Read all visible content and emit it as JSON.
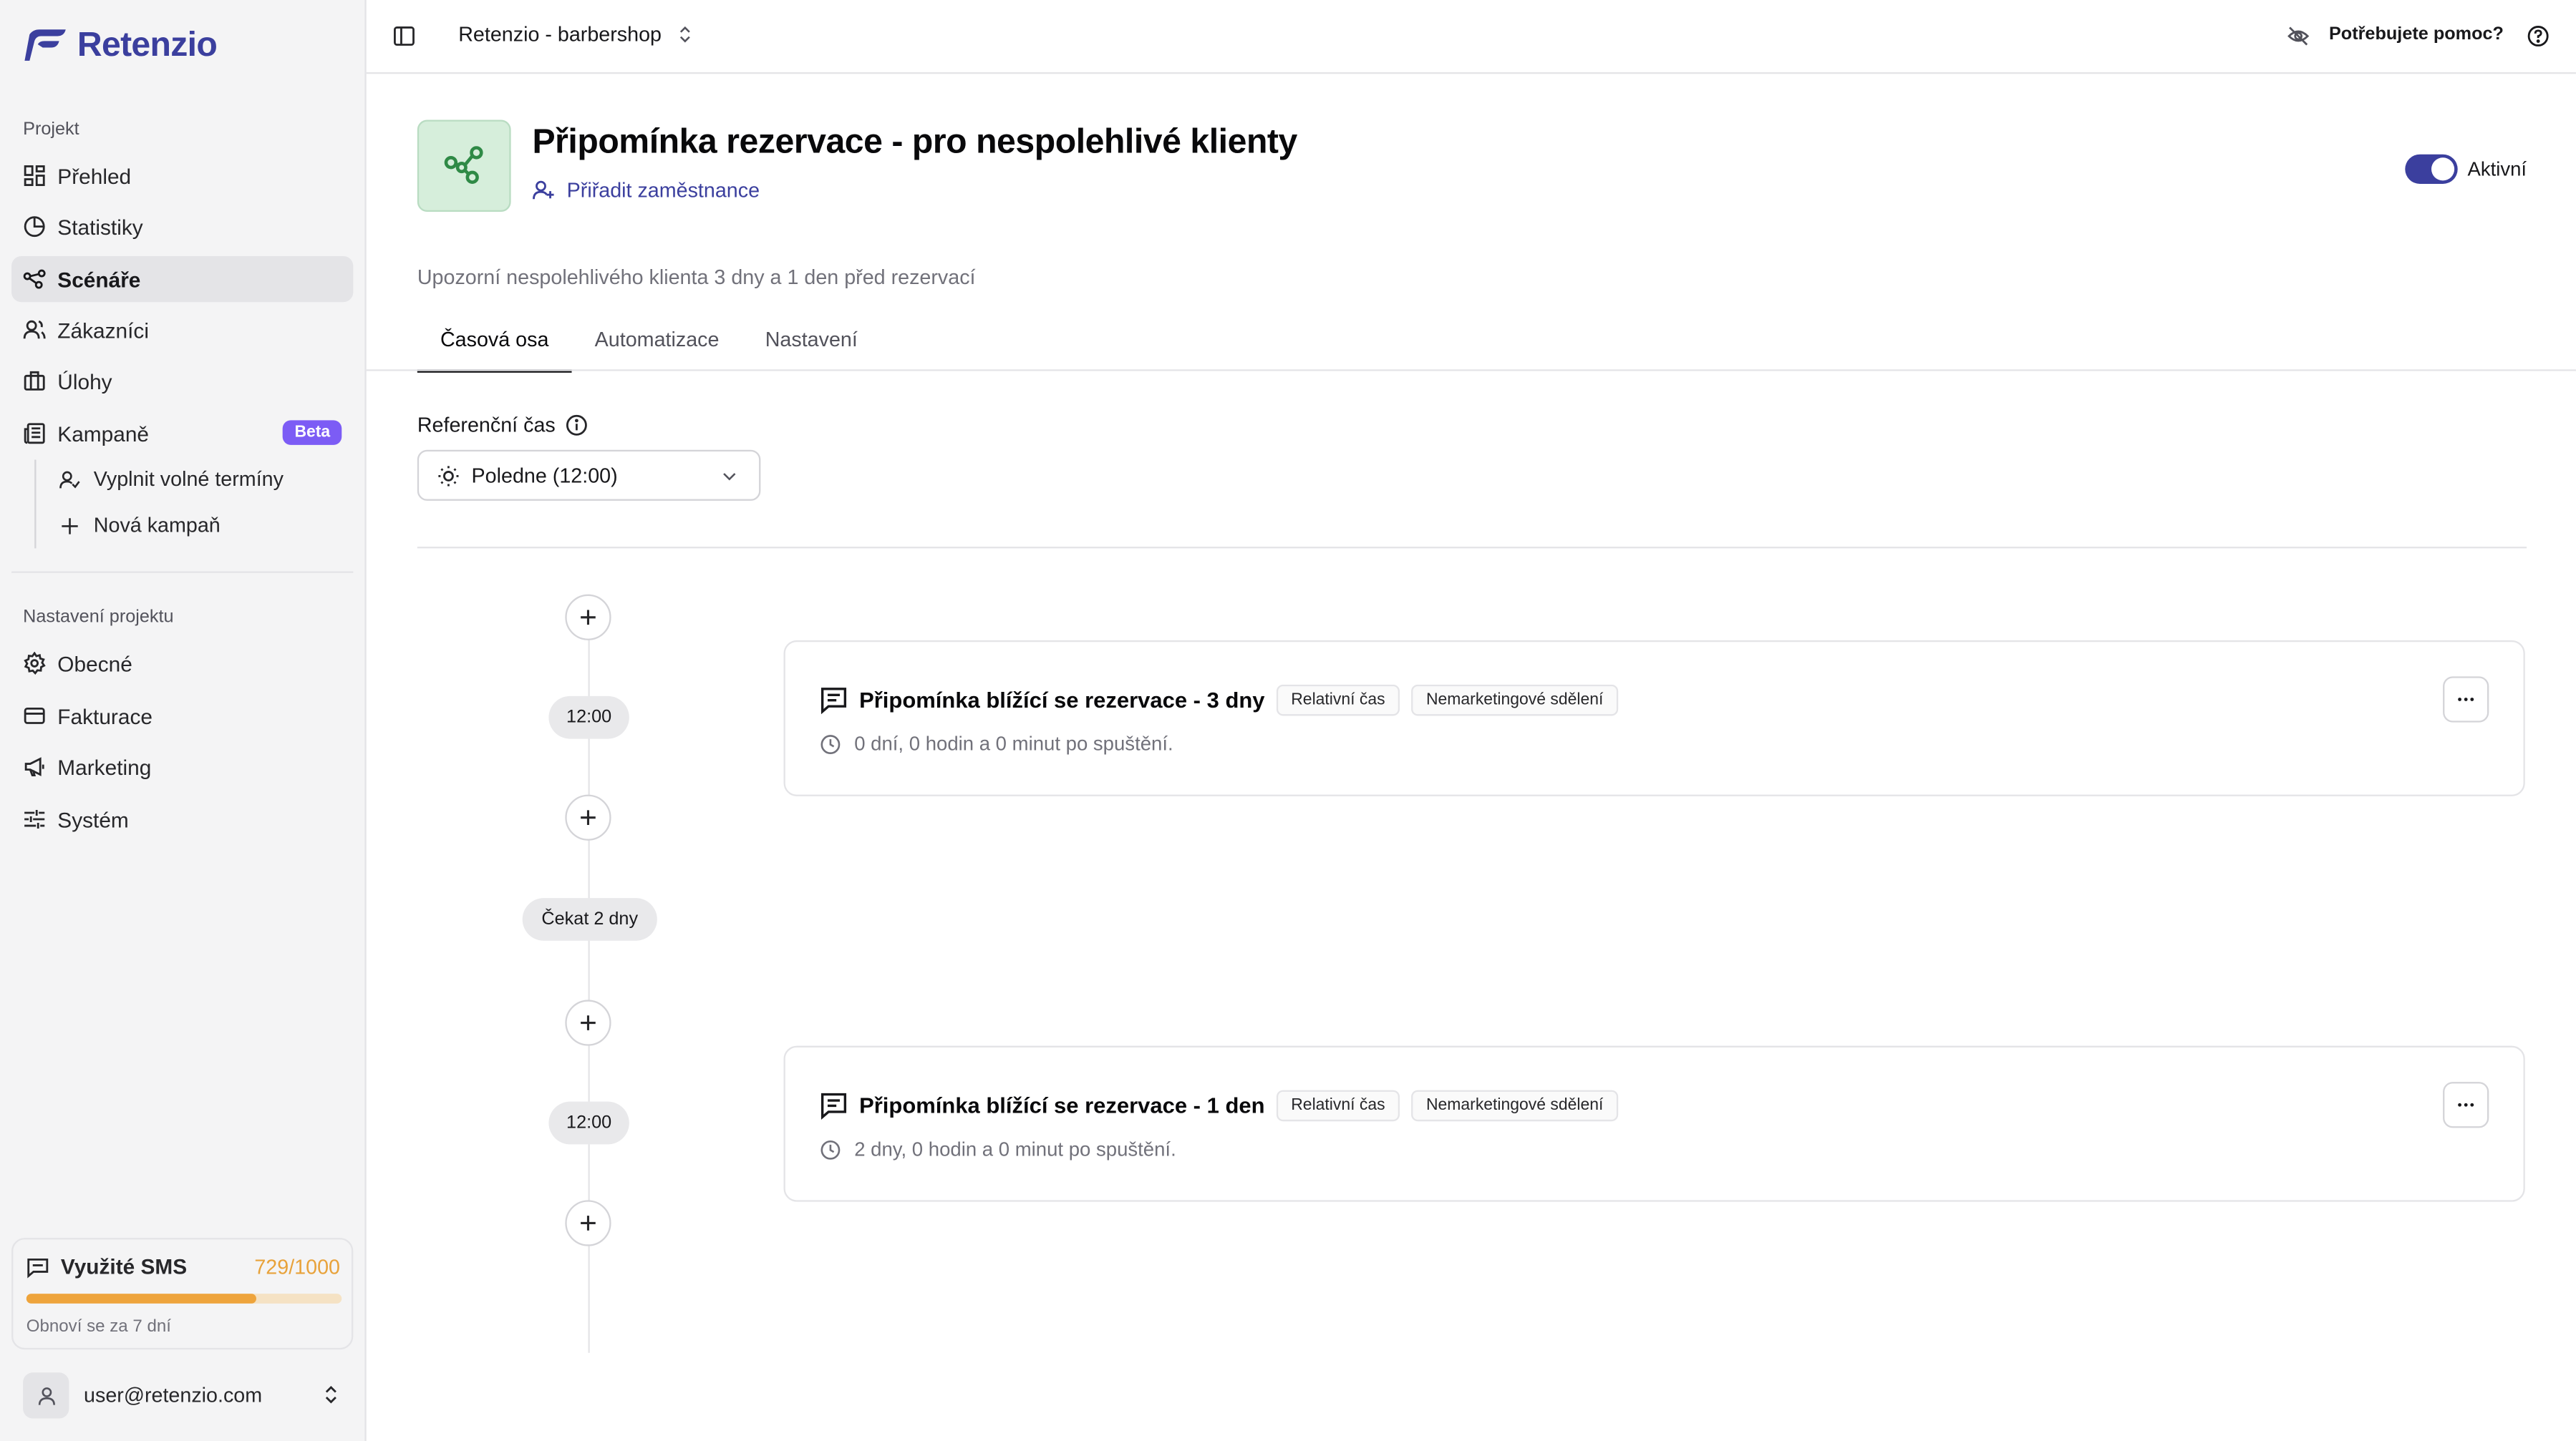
{
  "brand": {
    "name": "Retenzio",
    "color": "#3b3f9e"
  },
  "sidebar": {
    "section_project": "Projekt",
    "items": [
      {
        "label": "Přehled",
        "icon": "grid-icon"
      },
      {
        "label": "Statistiky",
        "icon": "pie-chart-icon"
      },
      {
        "label": "Scénáře",
        "icon": "workflow-icon",
        "active": true
      },
      {
        "label": "Zákazníci",
        "icon": "users-icon"
      },
      {
        "label": "Úlohy",
        "icon": "briefcase-icon"
      },
      {
        "label": "Kampaně",
        "icon": "newspaper-icon",
        "badge": "Beta"
      }
    ],
    "campaign_sub": [
      {
        "label": "Vyplnit volné termíny",
        "icon": "user-check-icon"
      },
      {
        "label": "Nová kampaň",
        "icon": "plus-icon"
      }
    ],
    "section_settings": "Nastavení projektu",
    "settings_items": [
      {
        "label": "Obecné",
        "icon": "gear-icon"
      },
      {
        "label": "Fakturace",
        "icon": "credit-card-icon"
      },
      {
        "label": "Marketing",
        "icon": "megaphone-icon"
      },
      {
        "label": "Systém",
        "icon": "sliders-icon"
      }
    ],
    "sms": {
      "title": "Využité SMS",
      "count": "729/1000",
      "used_fraction": 0.729,
      "renew": "Obnoví se za 7 dní"
    },
    "user": {
      "email": "user@retenzio.com"
    }
  },
  "topbar": {
    "project": "Retenzio - barbershop",
    "help": "Potřebujete pomoc?"
  },
  "scenario": {
    "title": "Připomínka rezervace - pro nespolehlivé klienty",
    "assign_label": "Přiřadit zaměstnance",
    "status_label": "Aktivní",
    "active": true,
    "description": "Upozorní nespolehlivého klienta 3 dny a 1 den před rezervací"
  },
  "tabs": [
    {
      "label": "Časová osa",
      "active": true
    },
    {
      "label": "Automatizace"
    },
    {
      "label": "Nastavení"
    }
  ],
  "reference_time": {
    "label": "Referenční čas",
    "value": "Poledne (12:00)"
  },
  "timeline": {
    "time_1": "12:00",
    "wait": "Čekat 2 dny",
    "time_2": "12:00",
    "steps": [
      {
        "title": "Připomínka blížící se rezervace - 3 dny",
        "tags": [
          "Relativní čas",
          "Nemarketingové sdělení"
        ],
        "delay": "0 dní, 0 hodin a 0 minut po spuštění."
      },
      {
        "title": "Připomínka blížící se rezervace - 1 den",
        "tags": [
          "Relativní čas",
          "Nemarketingové sdělení"
        ],
        "delay": "2 dny, 0 hodin a 0 minut po spuštění."
      }
    ]
  }
}
